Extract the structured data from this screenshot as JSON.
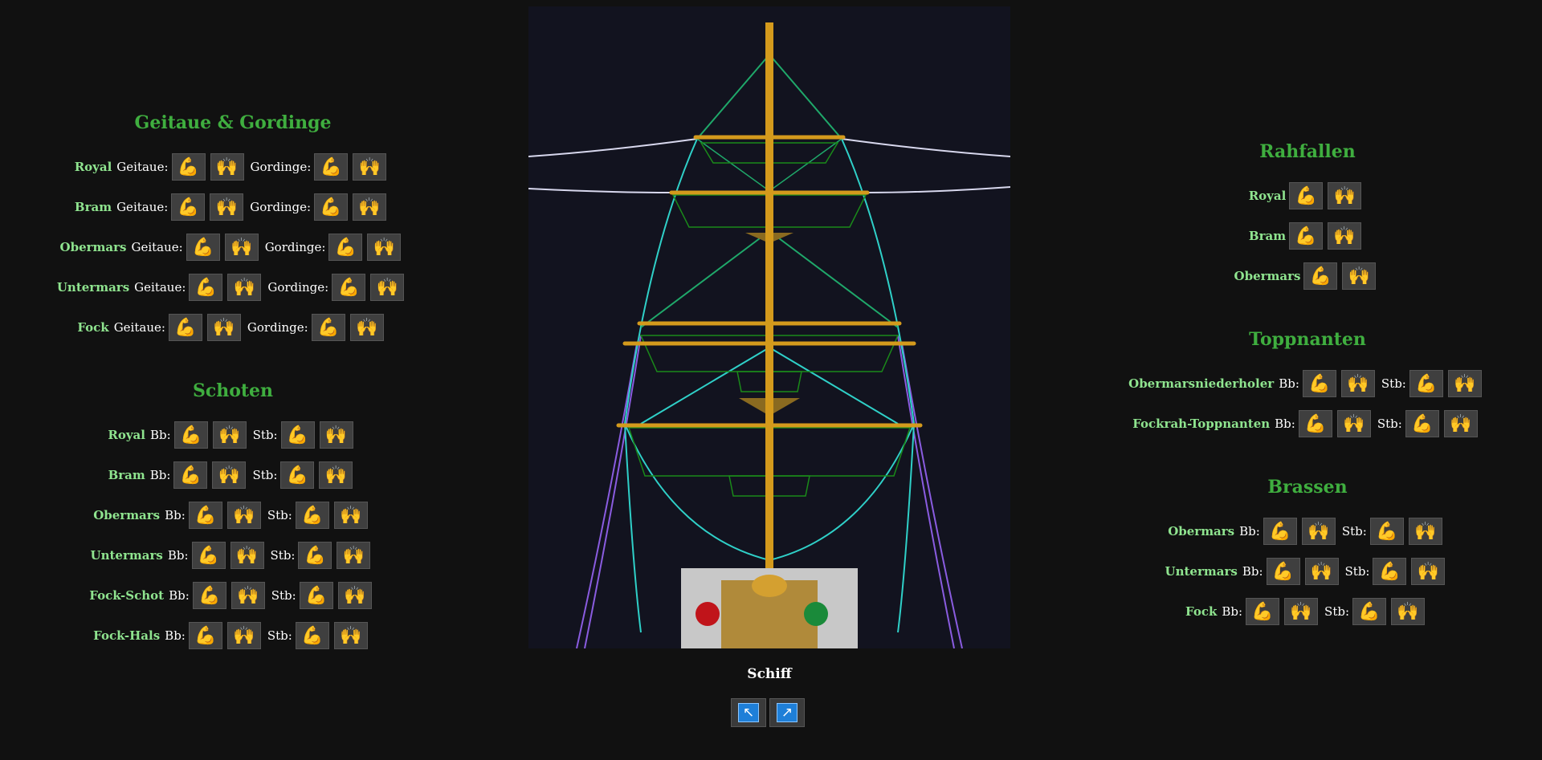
{
  "icons": {
    "pull": "💪",
    "release": "🙌"
  },
  "geitaue": {
    "title": "Geitaue & Gordinge",
    "label_a": "Geitaue:",
    "label_b": "Gordinge:",
    "rows": [
      "Royal",
      "Bram",
      "Obermars",
      "Untermars",
      "Fock"
    ]
  },
  "schoten": {
    "title": "Schoten",
    "label_a": "Bb:",
    "label_b": "Stb:",
    "rows": [
      "Royal",
      "Bram",
      "Obermars",
      "Untermars",
      "Fock-Schot",
      "Fock-Hals"
    ]
  },
  "rahfallen": {
    "title": "Rahfallen",
    "rows": [
      "Royal",
      "Bram",
      "Obermars"
    ]
  },
  "toppnanten": {
    "title": "Toppnanten",
    "label_a": "Bb:",
    "label_b": "Stb:",
    "rows": [
      "Obermarsniederholer",
      "Fockrah-Toppnanten"
    ]
  },
  "brassen": {
    "title": "Brassen",
    "label_a": "Bb:",
    "label_b": "Stb:",
    "rows": [
      "Obermars",
      "Untermars",
      "Fock"
    ]
  },
  "ship": {
    "caption": "Schiff",
    "nav_left": "↖",
    "nav_right": "↗"
  },
  "colors": {
    "background": "#111111",
    "heading": "#3fae3f",
    "row_name": "#8fe48f",
    "button": "#3f3f3f",
    "mast": "#d49a1c",
    "net": "#1a8a1a",
    "stay": "#2fd0c8",
    "shroud": "#8a5ce0"
  }
}
